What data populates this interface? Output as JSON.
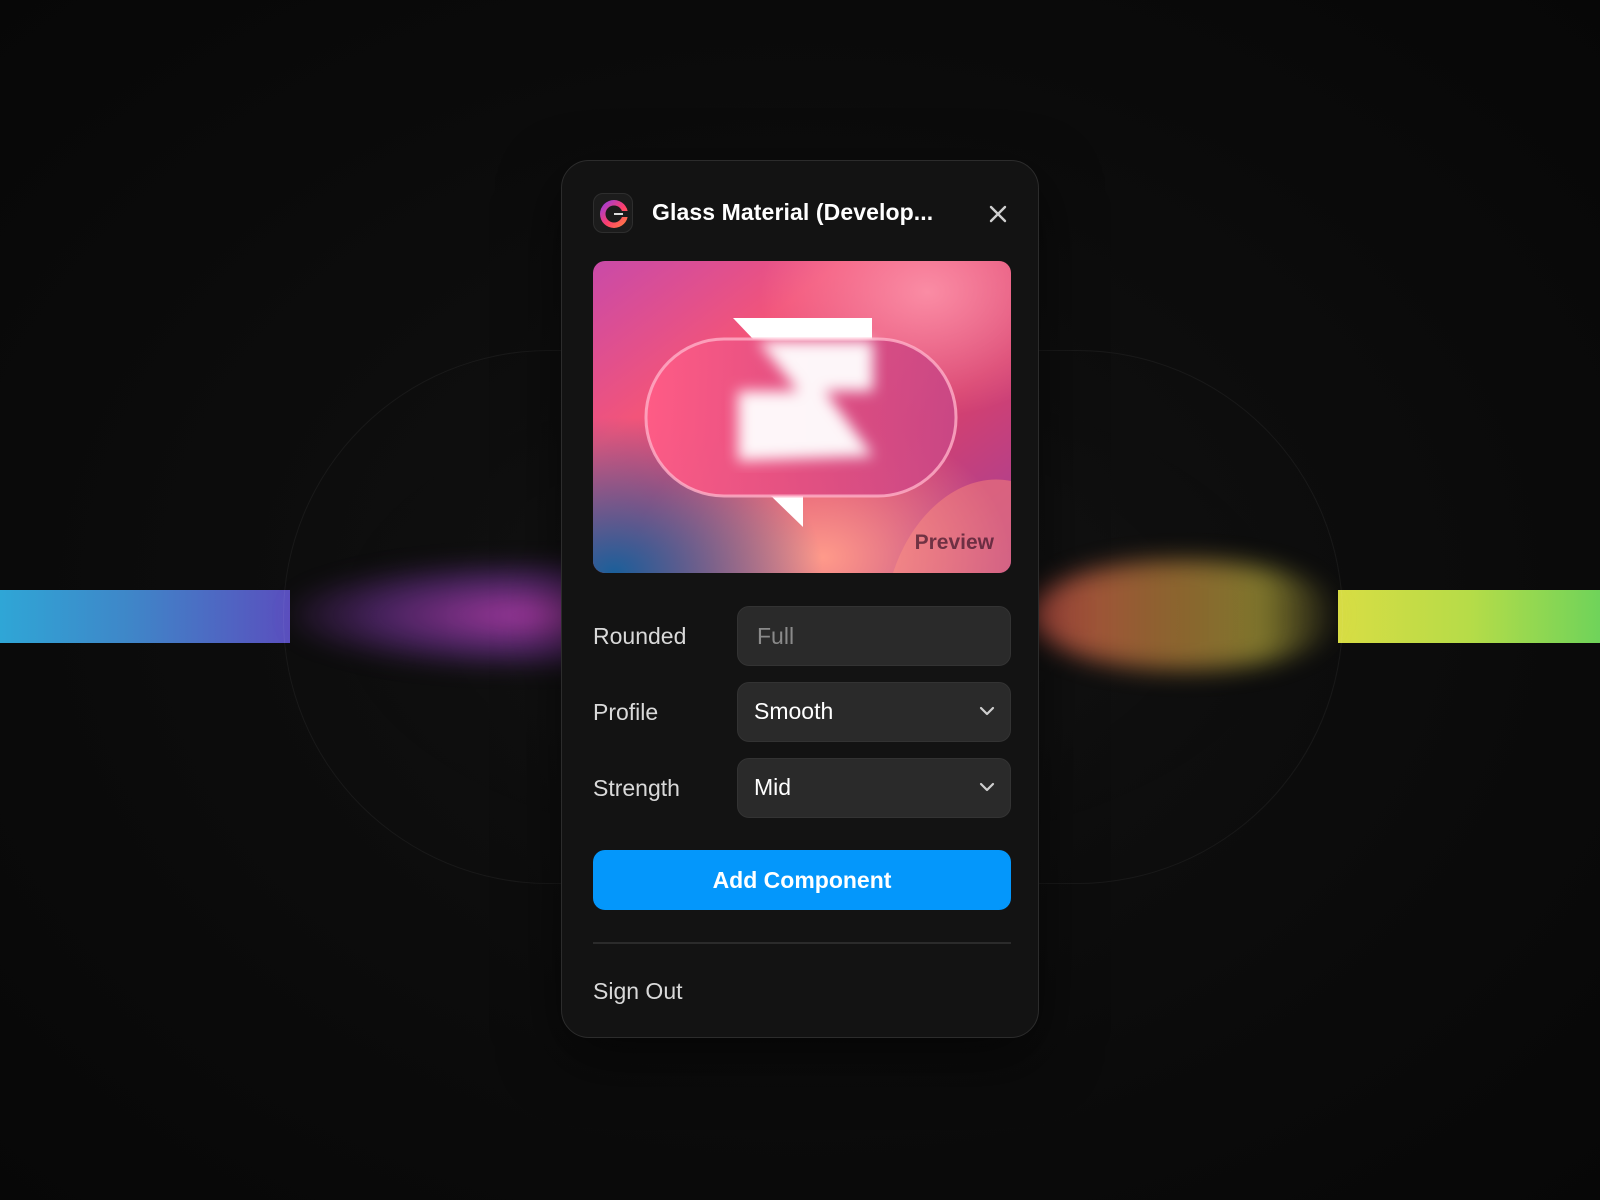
{
  "dialog": {
    "title": "Glass Material (Develop...",
    "app_icon": "glass-logo-icon",
    "close_icon": "close-icon"
  },
  "preview": {
    "label": "Preview"
  },
  "form": {
    "rounded": {
      "label": "Rounded",
      "placeholder": "Full"
    },
    "profile": {
      "label": "Profile",
      "value": "Smooth",
      "icon": "chevron-down-icon"
    },
    "strength": {
      "label": "Strength",
      "value": "Mid",
      "icon": "chevron-down-icon"
    }
  },
  "actions": {
    "add_label": "Add Component",
    "sign_out_label": "Sign Out"
  },
  "colors": {
    "accent": "#0497fb",
    "panel_bg": "#131313",
    "field_bg": "#2a2a2a",
    "page_bg": "#0b0b0b"
  }
}
